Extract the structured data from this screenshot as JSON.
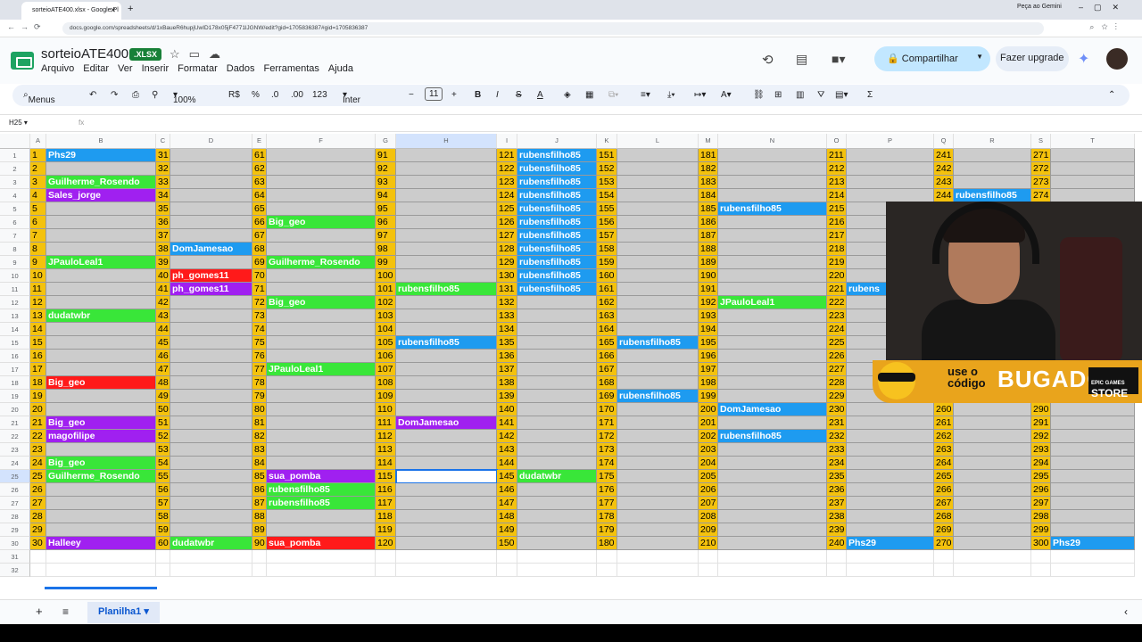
{
  "browser": {
    "tab_title": "sorteioATE400.xlsx - Google Pl",
    "url": "docs.google.com/spreadsheets/d/1xBaueR6hupjUwID178x05jF4771lJGNW/edit?gid=1705836387#gid=1705836387",
    "gemini": "Peça ao Gemini"
  },
  "doc": {
    "title": "sorteioATE400",
    "badge": ".XLSX"
  },
  "menu": [
    "Arquivo",
    "Editar",
    "Ver",
    "Inserir",
    "Formatar",
    "Dados",
    "Ferramentas",
    "Ajuda"
  ],
  "actions": {
    "share": "Compartilhar",
    "upgrade": "Fazer upgrade"
  },
  "toolbar": {
    "menus": "Menus",
    "zoom": "100%",
    "currency": "R$",
    "percent": "%",
    "dec_less": ".0",
    "dec_more": ".00",
    "numfmt": "123",
    "font": "Inter",
    "fontsize": "11"
  },
  "formula": {
    "namebox": "H25",
    "fx": "fx"
  },
  "columns": [
    "A",
    "B",
    "C",
    "D",
    "E",
    "F",
    "G",
    "H",
    "I",
    "J",
    "K",
    "L",
    "M",
    "N",
    "O",
    "P",
    "Q",
    "R",
    "S",
    "T"
  ],
  "names": {
    "B": {
      "1": [
        "Phs29",
        "b"
      ],
      "3": [
        "Guilherme_Rosendo",
        "g"
      ],
      "4": [
        "Sales_jorge",
        "p"
      ],
      "9": [
        "JPauloLeal1",
        "g"
      ],
      "13": [
        "dudatwbr",
        "g"
      ],
      "18": [
        "Big_geo",
        "r"
      ],
      "21": [
        "Big_geo",
        "p"
      ],
      "22": [
        "magofilipe",
        "p"
      ],
      "24": [
        "Big_geo",
        "g"
      ],
      "25": [
        "Guilherme_Rosendo",
        "g"
      ],
      "30": [
        "Halleey",
        "p"
      ]
    },
    "D": {
      "8": [
        "DomJamesao",
        "b"
      ],
      "10": [
        "ph_gomes11",
        "r"
      ],
      "11": [
        "ph_gomes11",
        "p"
      ],
      "30": [
        "dudatwbr",
        "g"
      ]
    },
    "F": {
      "6": [
        "Big_geo",
        "g"
      ],
      "9": [
        "Guilherme_Rosendo",
        "g"
      ],
      "12": [
        "Big_geo",
        "g"
      ],
      "17": [
        "JPauloLeal1",
        "g"
      ],
      "25": [
        "sua_pomba",
        "p"
      ],
      "26": [
        "rubensfilho85",
        "g"
      ],
      "27": [
        "rubensfilho85",
        "g"
      ],
      "30": [
        "sua_pomba",
        "r"
      ]
    },
    "H": {
      "11": [
        "rubensfilho85",
        "g"
      ],
      "15": [
        "rubensfilho85",
        "b"
      ],
      "21": [
        "DomJamesao",
        "p"
      ]
    },
    "J": {
      "1": [
        "rubensfilho85",
        "b"
      ],
      "2": [
        "rubensfilho85",
        "b"
      ],
      "3": [
        "rubensfilho85",
        "b"
      ],
      "4": [
        "rubensfilho85",
        "b"
      ],
      "5": [
        "rubensfilho85",
        "b"
      ],
      "6": [
        "rubensfilho85",
        "b"
      ],
      "7": [
        "rubensfilho85",
        "b"
      ],
      "8": [
        "rubensfilho85",
        "b"
      ],
      "9": [
        "rubensfilho85",
        "b"
      ],
      "10": [
        "rubensfilho85",
        "b"
      ],
      "11": [
        "rubensfilho85",
        "b"
      ],
      "25": [
        "dudatwbr",
        "g"
      ]
    },
    "L": {
      "15": [
        "rubensfilho85",
        "b"
      ],
      "19": [
        "rubensfilho85",
        "b"
      ]
    },
    "N": {
      "5": [
        "rubensfilho85",
        "b"
      ],
      "12": [
        "JPauloLeal1",
        "g"
      ],
      "20": [
        "DomJamesao",
        "b"
      ],
      "22": [
        "rubensfilho85",
        "b"
      ]
    },
    "P": {
      "11": [
        "rubens",
        "b"
      ],
      "30": [
        "Phs29",
        "b"
      ]
    },
    "R": {
      "4": [
        "rubensfilho85",
        "b"
      ]
    },
    "T": {
      "30": [
        "Phs29",
        "b"
      ]
    }
  },
  "sheet": {
    "tab": "Planilha1"
  },
  "overlay": {
    "promo_line1": "use o",
    "promo_line2": "código",
    "promo_code": "BUGADO",
    "store_small": "EPIC GAMES",
    "store": "STORE"
  },
  "colors": {
    "yellow": "#f4c20d",
    "b": "#1e9bf0",
    "g": "#39e639",
    "p": "#a020f0",
    "r": "#ff1a1a",
    "gray": "#cccccc"
  }
}
